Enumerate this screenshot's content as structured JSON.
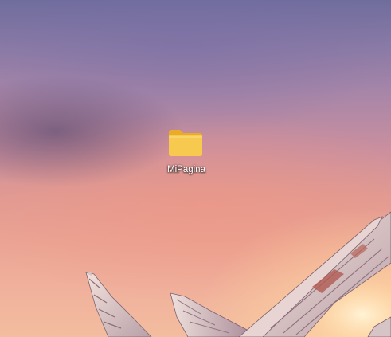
{
  "desktop": {
    "icons": [
      {
        "label": "MiPagina",
        "icon": "folder-icon"
      }
    ]
  },
  "colors": {
    "folder_body": "#f7c94e",
    "folder_back": "#e9ab28",
    "label_text": "#ffffff"
  }
}
